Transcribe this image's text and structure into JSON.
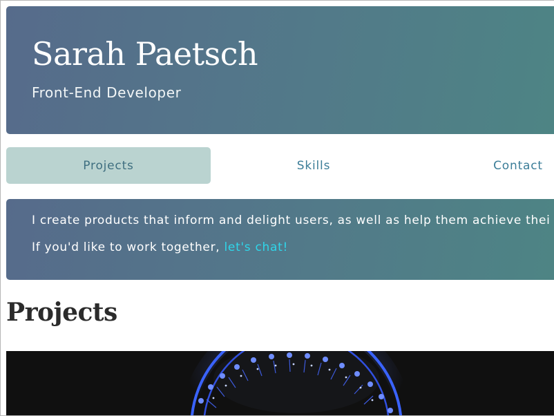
{
  "hero": {
    "name": "Sarah Paetsch",
    "role": "Front-End Developer"
  },
  "nav": {
    "items": [
      {
        "label": "Projects",
        "active": true
      },
      {
        "label": "Skills",
        "active": false
      },
      {
        "label": "Contact",
        "active": false
      }
    ]
  },
  "intro": {
    "line1": "I create products that inform and delight users, as well as help them achieve thei",
    "line2_prefix": "If you'd like to work together, ",
    "line2_link": "let's chat!"
  },
  "projects": {
    "title": "Projects",
    "image_icon": "ferris-wheel-photo"
  },
  "colors": {
    "panel_start": "#566b8b",
    "panel_end": "#4d8584",
    "nav_active_bg": "#bad3d0",
    "nav_text": "#3b7d98",
    "link": "#2fd6ea",
    "wheel_lights": "#3a63ff"
  }
}
